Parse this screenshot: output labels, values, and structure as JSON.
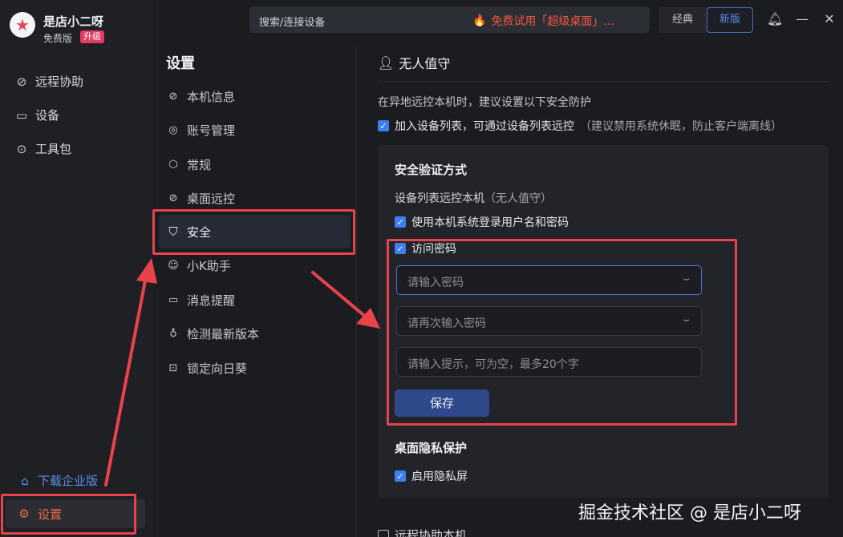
{
  "app": {
    "name": "是店小二呀",
    "plan": "免费版",
    "upgrade": "升级",
    "logo_icon": "star-logo-icon"
  },
  "sidebar": {
    "items": [
      {
        "label": "远程协助",
        "icon": "remote-assist-icon"
      },
      {
        "label": "设备",
        "icon": "monitor-icon"
      },
      {
        "label": "工具包",
        "icon": "compass-icon"
      }
    ],
    "download": "下载企业版",
    "settings": "设置"
  },
  "topbar": {
    "search_label": "搜索/连接设备",
    "promo": "免费试用「超级桌面」...",
    "mode_classic": "经典",
    "mode_new": "新版"
  },
  "settings_menu": {
    "title": "设置",
    "items": [
      {
        "label": "本机信息",
        "icon": "info-icon"
      },
      {
        "label": "账号管理",
        "icon": "account-icon"
      },
      {
        "label": "常规",
        "icon": "cube-icon"
      },
      {
        "label": "桌面远控",
        "icon": "remote-desktop-icon"
      },
      {
        "label": "安全",
        "icon": "shield-icon",
        "active": true
      },
      {
        "label": "小K助手",
        "icon": "bot-icon"
      },
      {
        "label": "消息提醒",
        "icon": "message-icon"
      },
      {
        "label": "检测最新版本",
        "icon": "bell-icon"
      },
      {
        "label": "锁定向日葵",
        "icon": "lock-icon"
      }
    ]
  },
  "main": {
    "title": "无人值守",
    "intro": "在异地远控本机时，建议设置以下安全防护",
    "add_to_list": "加入设备列表，可通过设备列表远控",
    "add_to_list_hint": "（建议禁用系统休眠，防止客户端离线）",
    "auth_heading": "安全验证方式",
    "list_remote": "设备列表远控本机",
    "list_remote_hint": "（无人值守）",
    "use_system_login": "使用本机系统登录用户名和密码",
    "access_password": "访问密码",
    "password_placeholder": "请输入密码",
    "password_confirm_placeholder": "请再次输入密码",
    "hint_placeholder": "请输入提示，可为空，最多20个字",
    "save": "保存",
    "privacy_heading": "桌面隐私保护",
    "privacy_screen": "启用隐私屏",
    "next_section": "远程协助本机"
  },
  "watermark": "掘金技术社区 @ 是店小二呀",
  "colors": {
    "accent_blue": "#3b7ff0",
    "highlight_red": "#e8434a",
    "promo_orange": "#f0573e",
    "upgrade_pink": "#e23a62"
  }
}
